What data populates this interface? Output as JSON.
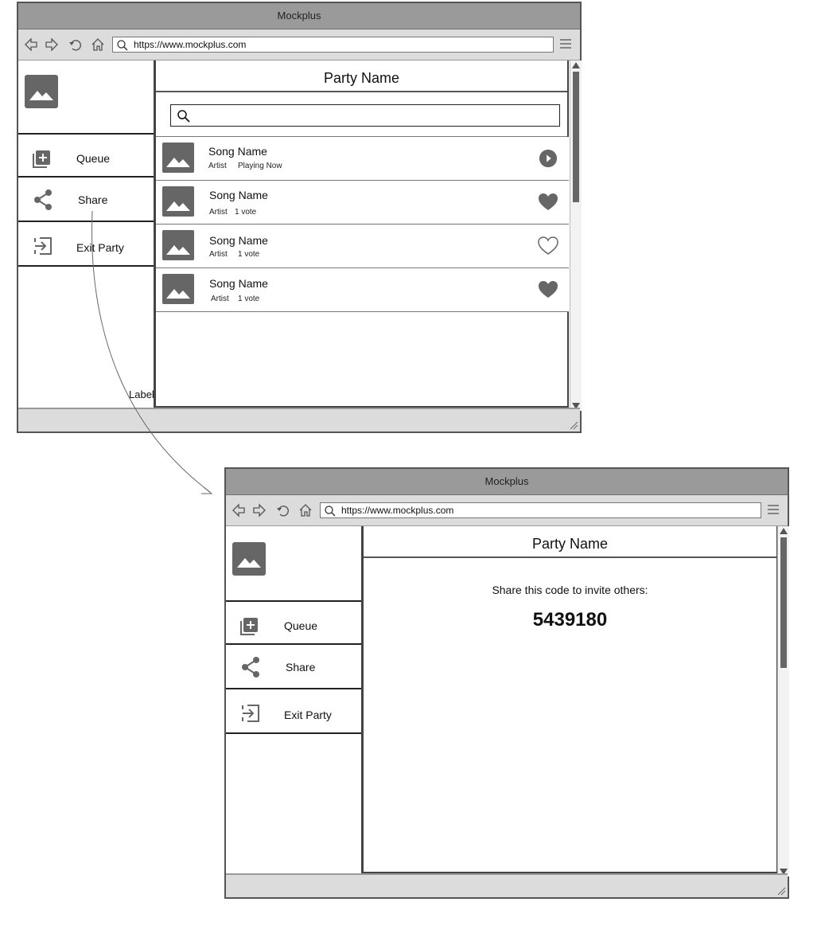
{
  "browser_1": {
    "title": "Mockplus",
    "url": "https://www.mockplus.com",
    "sidebar": {
      "items": [
        {
          "label": "Queue",
          "icon": "queue-add-icon"
        },
        {
          "label": "Share",
          "icon": "share-icon"
        },
        {
          "label": "Exit Party",
          "icon": "exit-icon"
        }
      ]
    },
    "main": {
      "title": "Party Name",
      "search_placeholder": "",
      "songs": [
        {
          "name": "Song Name",
          "artist": "Artist",
          "status": "Playing Now",
          "action_icon": "play-circle-icon"
        },
        {
          "name": "Song Name",
          "artist": "Artist",
          "status": "1 vote",
          "action_icon": "heart-filled-icon"
        },
        {
          "name": "Song Name",
          "artist": "Artist",
          "status": "1 vote",
          "action_icon": "heart-outline-icon"
        },
        {
          "name": "Song Name",
          "artist": "Artist",
          "status": "1 vote",
          "action_icon": "heart-filled-icon"
        }
      ]
    }
  },
  "connector_label": "Label",
  "browser_2": {
    "title": "Mockplus",
    "url": "https://www.mockplus.com",
    "sidebar": {
      "items": [
        {
          "label": "Queue",
          "icon": "queue-add-icon"
        },
        {
          "label": "Share",
          "icon": "share-icon"
        },
        {
          "label": "Exit Party",
          "icon": "exit-icon"
        }
      ]
    },
    "main": {
      "title": "Party Name",
      "share_text": "Share this code to invite others:",
      "code": "5439180"
    }
  },
  "colors": {
    "titlebar": "#9a9a9a",
    "toolbar": "#dcdcdc",
    "icon_gray": "#666666",
    "border": "#555555"
  }
}
